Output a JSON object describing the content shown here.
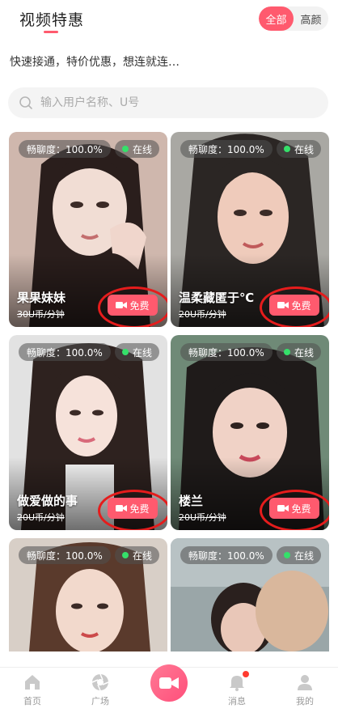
{
  "header": {
    "title": "视频特惠",
    "tabs": [
      "全部",
      "高颜"
    ],
    "active_tab": 0
  },
  "subtitle": "快速接通，特价优惠，想连就连…",
  "search": {
    "placeholder": "输入用户名称、U号"
  },
  "cards": [
    {
      "rate_label": "畅聊度：100.0%",
      "status": "在线",
      "name": "果果妹妹",
      "price": "30U币/分钟",
      "button": "免费",
      "highlighted": true
    },
    {
      "rate_label": "畅聊度：100.0%",
      "status": "在线",
      "name": "温柔藏匿于℃",
      "price": "20U币/分钟",
      "button": "免费",
      "highlighted": true
    },
    {
      "rate_label": "畅聊度：100.0%",
      "status": "在线",
      "name": "做爱做的事",
      "price": "20U币/分钟",
      "button": "免费",
      "highlighted": true
    },
    {
      "rate_label": "畅聊度：100.0%",
      "status": "在线",
      "name": "楼兰",
      "price": "20U币/分钟",
      "button": "免费",
      "highlighted": true
    },
    {
      "rate_label": "畅聊度：100.0%",
      "status": "在线",
      "name": "",
      "price": "",
      "button": "",
      "highlighted": false
    },
    {
      "rate_label": "畅聊度：100.0%",
      "status": "在线",
      "name": "",
      "price": "",
      "button": "",
      "highlighted": false
    }
  ],
  "tabbar": {
    "items": [
      "首页",
      "广场",
      "",
      "消息",
      "我的"
    ]
  },
  "colors": {
    "accent": "#ff5a6e",
    "online": "#35e06a",
    "annotation": "#e51c1c"
  }
}
